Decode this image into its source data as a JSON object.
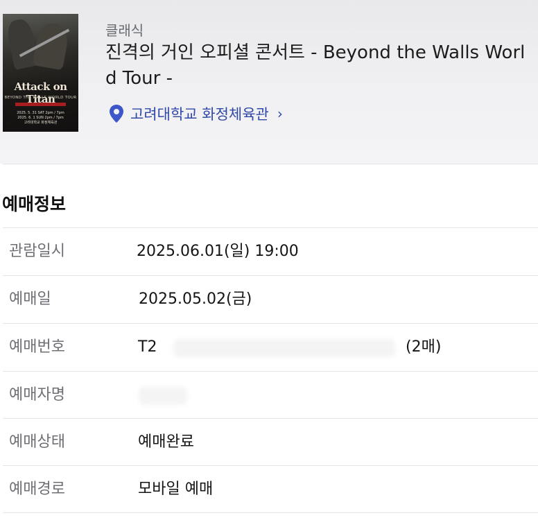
{
  "event": {
    "category": "클래식",
    "title": "진격의 거인 오피셜 콘서트 - Beyond the Walls World Tour -",
    "title_line1": "진격의 거인 오피셜 콘서트 - Beyond the Walls Worl",
    "title_line2": "d Tour -",
    "venue": "고려대학교 화정체육관",
    "venue_chevron": "›"
  },
  "poster": {
    "title": "Attack on Titan",
    "subtitle": "BEYOND THE WALLS WORLD TOUR",
    "dates": [
      "2025. 5. 31 SAT 2pm / 7pm",
      "2025. 6. 1 SUN 2pm / 7pm",
      "고려대학교 화정체육관"
    ]
  },
  "booking": {
    "section_title": "예매정보",
    "rows": [
      {
        "label": "관람일시",
        "value": "2025.06.01(일) 19:00"
      },
      {
        "label": "예매일",
        "value": "2025.05.02(금)"
      },
      {
        "label": "예매번호",
        "value": "T2",
        "extra": "(2매)"
      },
      {
        "label": "예매자명",
        "value": ""
      },
      {
        "label": "예매상태",
        "value": "예매완료"
      },
      {
        "label": "예매경로",
        "value": "모바일 예매"
      }
    ]
  },
  "icons": {
    "location": "map-pin-icon",
    "chevron": "chevron-right-icon"
  },
  "colors": {
    "accent": "#2f48a7",
    "pin": "#3d57c8",
    "label": "#6e6e74"
  }
}
